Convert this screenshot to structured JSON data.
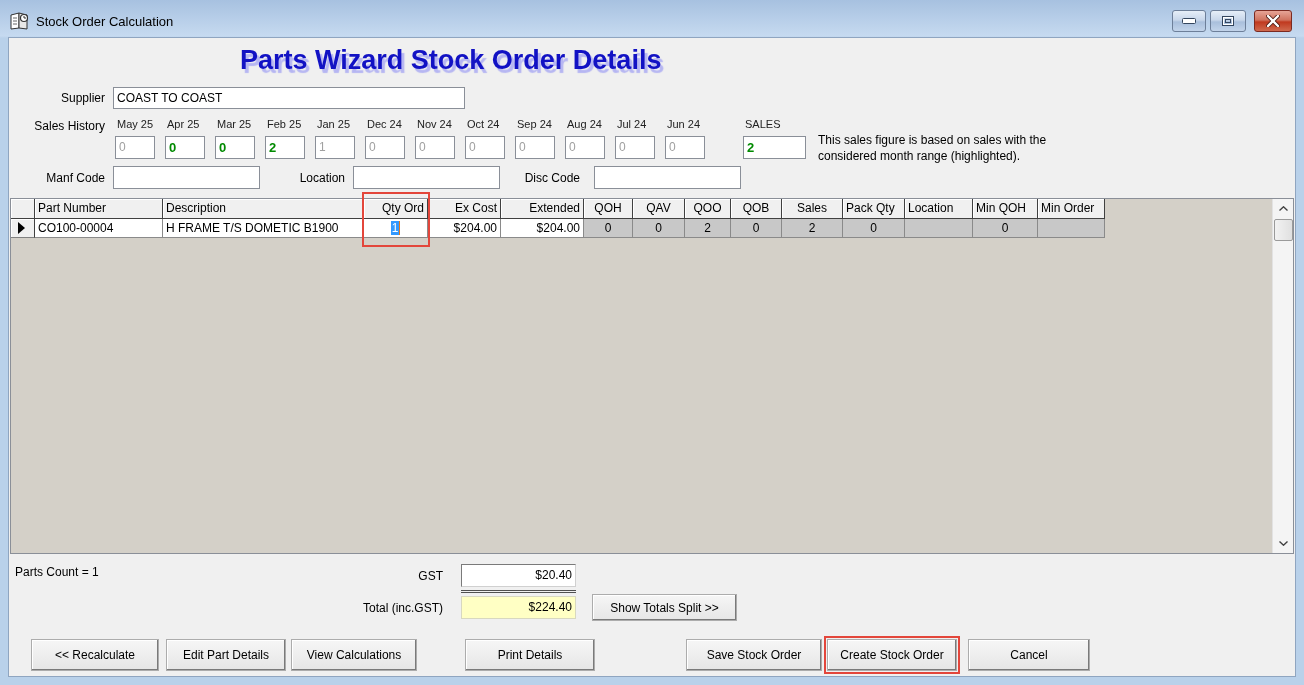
{
  "window": {
    "title": "Stock Order Calculation"
  },
  "heading": "Parts Wizard Stock Order Details",
  "supplier": {
    "label": "Supplier",
    "value": "COAST TO COAST"
  },
  "sales_history": {
    "label": "Sales History",
    "months": [
      {
        "label": "May 25",
        "value": "0",
        "highlighted": false
      },
      {
        "label": "Apr 25",
        "value": "0",
        "highlighted": true
      },
      {
        "label": "Mar 25",
        "value": "0",
        "highlighted": true
      },
      {
        "label": "Feb 25",
        "value": "2",
        "highlighted": true
      },
      {
        "label": "Jan 25",
        "value": "1",
        "highlighted": false
      },
      {
        "label": "Dec 24",
        "value": "0",
        "highlighted": false
      },
      {
        "label": "Nov 24",
        "value": "0",
        "highlighted": false
      },
      {
        "label": "Oct 24",
        "value": "0",
        "highlighted": false
      },
      {
        "label": "Sep 24",
        "value": "0",
        "highlighted": false
      },
      {
        "label": "Aug 24",
        "value": "0",
        "highlighted": false
      },
      {
        "label": "Jul 24",
        "value": "0",
        "highlighted": false
      },
      {
        "label": "Jun 24",
        "value": "0",
        "highlighted": false
      }
    ]
  },
  "sales_total": {
    "label": "SALES",
    "value": "2",
    "highlighted": true,
    "note": "This sales figure is based on sales with the considered month range (highlighted)."
  },
  "code_fields": [
    {
      "label": "Manf Code"
    },
    {
      "label": "Location"
    },
    {
      "label": "Disc Code"
    }
  ],
  "grid": {
    "columns": [
      {
        "label": "Part Number",
        "readonly": false,
        "highlighted": false
      },
      {
        "label": "Description",
        "readonly": false,
        "highlighted": false
      },
      {
        "label": "Qty Ord",
        "readonly": false,
        "highlighted": true
      },
      {
        "label": "Ex Cost",
        "readonly": false,
        "highlighted": false
      },
      {
        "label": "Extended",
        "readonly": false,
        "highlighted": false
      },
      {
        "label": "QOH",
        "readonly": true,
        "highlighted": false
      },
      {
        "label": "QAV",
        "readonly": true,
        "highlighted": false
      },
      {
        "label": "QOO",
        "readonly": true,
        "highlighted": false
      },
      {
        "label": "QOB",
        "readonly": true,
        "highlighted": false
      },
      {
        "label": "Sales",
        "readonly": true,
        "highlighted": false
      },
      {
        "label": "Pack Qty",
        "readonly": true,
        "highlighted": false
      },
      {
        "label": "Location",
        "readonly": true,
        "highlighted": false
      },
      {
        "label": "Min QOH",
        "readonly": true,
        "highlighted": false
      },
      {
        "label": "Min Order",
        "readonly": true,
        "highlighted": false
      }
    ],
    "rows": [
      {
        "current": true,
        "cells": [
          {
            "text": "CO100-00004",
            "selected": false
          },
          {
            "text": "H FRAME T/S DOMETIC B1900",
            "selected": false
          },
          {
            "text": "1",
            "selected": true
          },
          {
            "text": "$204.00",
            "selected": false
          },
          {
            "text": "$204.00",
            "selected": false
          },
          {
            "text": "0",
            "selected": false
          },
          {
            "text": "0",
            "selected": false
          },
          {
            "text": "2",
            "selected": false
          },
          {
            "text": "0",
            "selected": false
          },
          {
            "text": "2",
            "selected": false
          },
          {
            "text": "0",
            "selected": false
          },
          {
            "selected": false
          },
          {
            "text": "0",
            "selected": false
          },
          {
            "selected": false
          }
        ]
      }
    ]
  },
  "parts_count": "Parts Count = 1",
  "totals": [
    {
      "kind": "subtotal",
      "label": "GST",
      "value": "$20.40"
    },
    {
      "kind": "total",
      "label": "Total (inc.GST)",
      "value": "$224.40"
    }
  ],
  "totals_split_button": "Show Totals Split >>",
  "buttons": [
    {
      "label": "<< Recalculate",
      "highlighted": false
    },
    {
      "label": "Edit Part Details",
      "highlighted": false
    },
    {
      "label": "View Calculations",
      "highlighted": false
    },
    {
      "label": "Print Details",
      "highlighted": false
    },
    {
      "label": "Save Stock Order",
      "highlighted": false
    },
    {
      "label": "Create Stock Order",
      "highlighted": true
    },
    {
      "label": "Cancel",
      "highlighted": false
    }
  ]
}
